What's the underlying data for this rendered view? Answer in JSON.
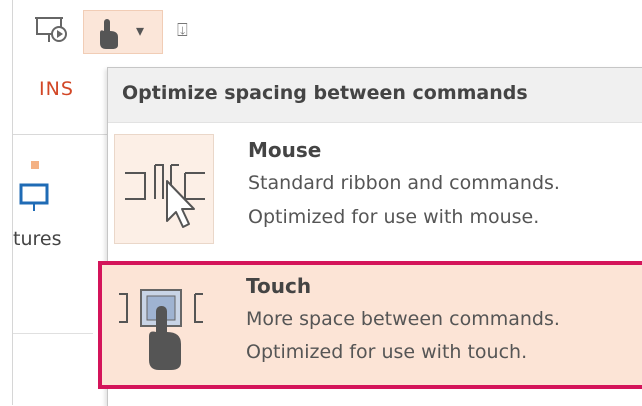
{
  "quick_access": {
    "present_icon": "from-beginning-slideshow-icon",
    "touch_mode_icon": "touch-mouse-mode-icon",
    "dropdown_glyph": "▾",
    "customize_glyph": "⍗"
  },
  "ribbon": {
    "active_tab": "INS",
    "pictures_label": "tures"
  },
  "menu": {
    "header": "Optimize spacing between commands",
    "items": [
      {
        "title": "Mouse",
        "line1": "Standard ribbon and commands.",
        "line2": "Optimized for use with mouse.",
        "icon": "mouse-mode-icon",
        "selected": false
      },
      {
        "title": "Touch",
        "line1": "More space between commands.",
        "line2": "Optimized for use with touch.",
        "icon": "touch-mode-icon",
        "selected": true
      }
    ]
  },
  "colors": {
    "accent_tab": "#d24726",
    "highlight": "#d4145a",
    "selected_bg": "#fce4d6"
  }
}
